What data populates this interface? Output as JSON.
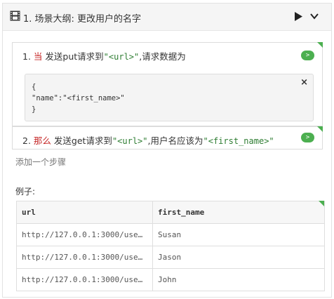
{
  "header": {
    "title": "1. 场景大纲: 更改用户的名字",
    "film_icon": "film-icon",
    "play_icon": "play-icon",
    "collapse_icon": "chevron-down-icon"
  },
  "steps": [
    {
      "number": "1.",
      "keyword": "当",
      "text_a": " 发送put请求到",
      "arg": "\"<url>\"",
      "text_b": ",请求数据为",
      "run_label": ">"
    },
    {
      "number": "2.",
      "keyword": "那么",
      "text_a": " 发送get请求到",
      "arg": "\"<url>\"",
      "text_b": ",用户名应该为",
      "arg2": "\"<first_name>\"",
      "run_label": ">"
    }
  ],
  "docstring": {
    "content": "{\n\"name\":\"<first_name>\"\n}",
    "close_label": "×"
  },
  "add_step_label": "添加一个步骤",
  "examples_label": "例子:",
  "examples": {
    "columns": [
      "url",
      "first_name"
    ],
    "rows": [
      [
        "http://127.0.0.1:3000/use…",
        "Susan"
      ],
      [
        "http://127.0.0.1:3000/use…",
        "Jason"
      ],
      [
        "http://127.0.0.1:3000/use…",
        "John"
      ]
    ]
  },
  "colors": {
    "accent": "#4caf50",
    "keyword": "#c62828",
    "string": "#2e7d32"
  }
}
